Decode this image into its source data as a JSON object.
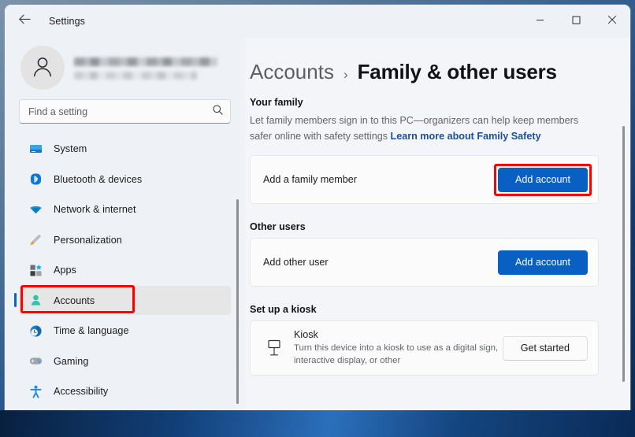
{
  "window": {
    "title": "Settings",
    "back_icon": "back-arrow-icon",
    "controls": {
      "minimize": "minimize-icon",
      "maximize": "maximize-icon",
      "close": "close-icon"
    }
  },
  "sidebar": {
    "profile": {
      "avatar_icon": "person-avatar-icon",
      "name": "",
      "email": ""
    },
    "search": {
      "placeholder": "Find a setting",
      "value": "",
      "icon": "search-icon"
    },
    "items": [
      {
        "label": "System",
        "icon": "monitor-icon",
        "selected": false
      },
      {
        "label": "Bluetooth & devices",
        "icon": "bluetooth-icon",
        "selected": false
      },
      {
        "label": "Network & internet",
        "icon": "wifi-icon",
        "selected": false
      },
      {
        "label": "Personalization",
        "icon": "paintbrush-icon",
        "selected": false
      },
      {
        "label": "Apps",
        "icon": "apps-grid-icon",
        "selected": false
      },
      {
        "label": "Accounts",
        "icon": "person-icon",
        "selected": true
      },
      {
        "label": "Time & language",
        "icon": "clock-globe-icon",
        "selected": false
      },
      {
        "label": "Gaming",
        "icon": "gamepad-icon",
        "selected": false
      },
      {
        "label": "Accessibility",
        "icon": "accessibility-icon",
        "selected": false
      }
    ]
  },
  "main": {
    "breadcrumb": {
      "parent": "Accounts",
      "separator": "›",
      "current": "Family & other users"
    },
    "sections": [
      {
        "title": "Your family",
        "description": "Let family members sign in to this PC—organizers can help keep members safer online with safety settings",
        "link": "Learn more about Family Safety",
        "card": {
          "label": "Add a family member",
          "button": "Add account",
          "button_style": "primary",
          "highlighted": true
        }
      },
      {
        "title": "Other users",
        "card": {
          "label": "Add other user",
          "button": "Add account",
          "button_style": "primary",
          "highlighted": false
        }
      },
      {
        "title": "Set up a kiosk",
        "card": {
          "icon": "kiosk-icon",
          "title": "Kiosk",
          "subtitle": "Turn this device into a kiosk to use as a digital sign, interactive display, or other",
          "button": "Get started",
          "button_style": "secondary",
          "highlighted": false
        }
      }
    ]
  },
  "annotations": {
    "color": "#fe0000",
    "targets": [
      "sidebar-item-accounts",
      "add-family-member-add-account-button"
    ]
  },
  "colors": {
    "accent": "#0a5fc2",
    "link": "#1a4f9c",
    "window_bg": "#eef2f7",
    "content_bg": "#f3f5f9",
    "card_bg": "#fbfbfb",
    "annotation": "#fe0000"
  }
}
